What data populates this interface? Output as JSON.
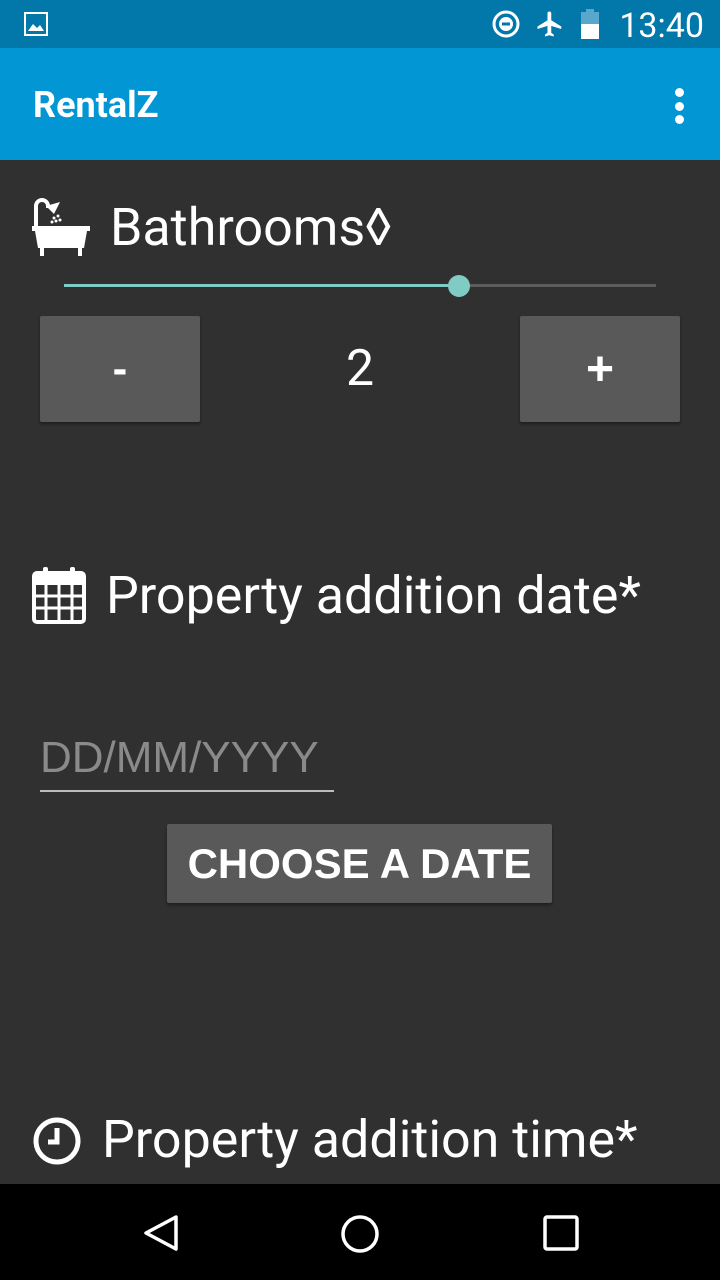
{
  "status_bar": {
    "time": "13:40",
    "battery_level": "44",
    "icons": [
      "image-icon",
      "do-not-disturb-icon",
      "airplane-icon",
      "battery-icon"
    ]
  },
  "app_bar": {
    "title": "RentalZ"
  },
  "bathrooms": {
    "label": "Bathrooms◊",
    "value": "2",
    "slider_fraction": 0.667,
    "decrement_label": "-",
    "increment_label": "+",
    "accent": "#80cbc4"
  },
  "date": {
    "label": "Property addition date*",
    "placeholder": "DD/MM/YYYY",
    "choose_label": "CHOOSE A DATE"
  },
  "time": {
    "label": "Property addition time*"
  }
}
